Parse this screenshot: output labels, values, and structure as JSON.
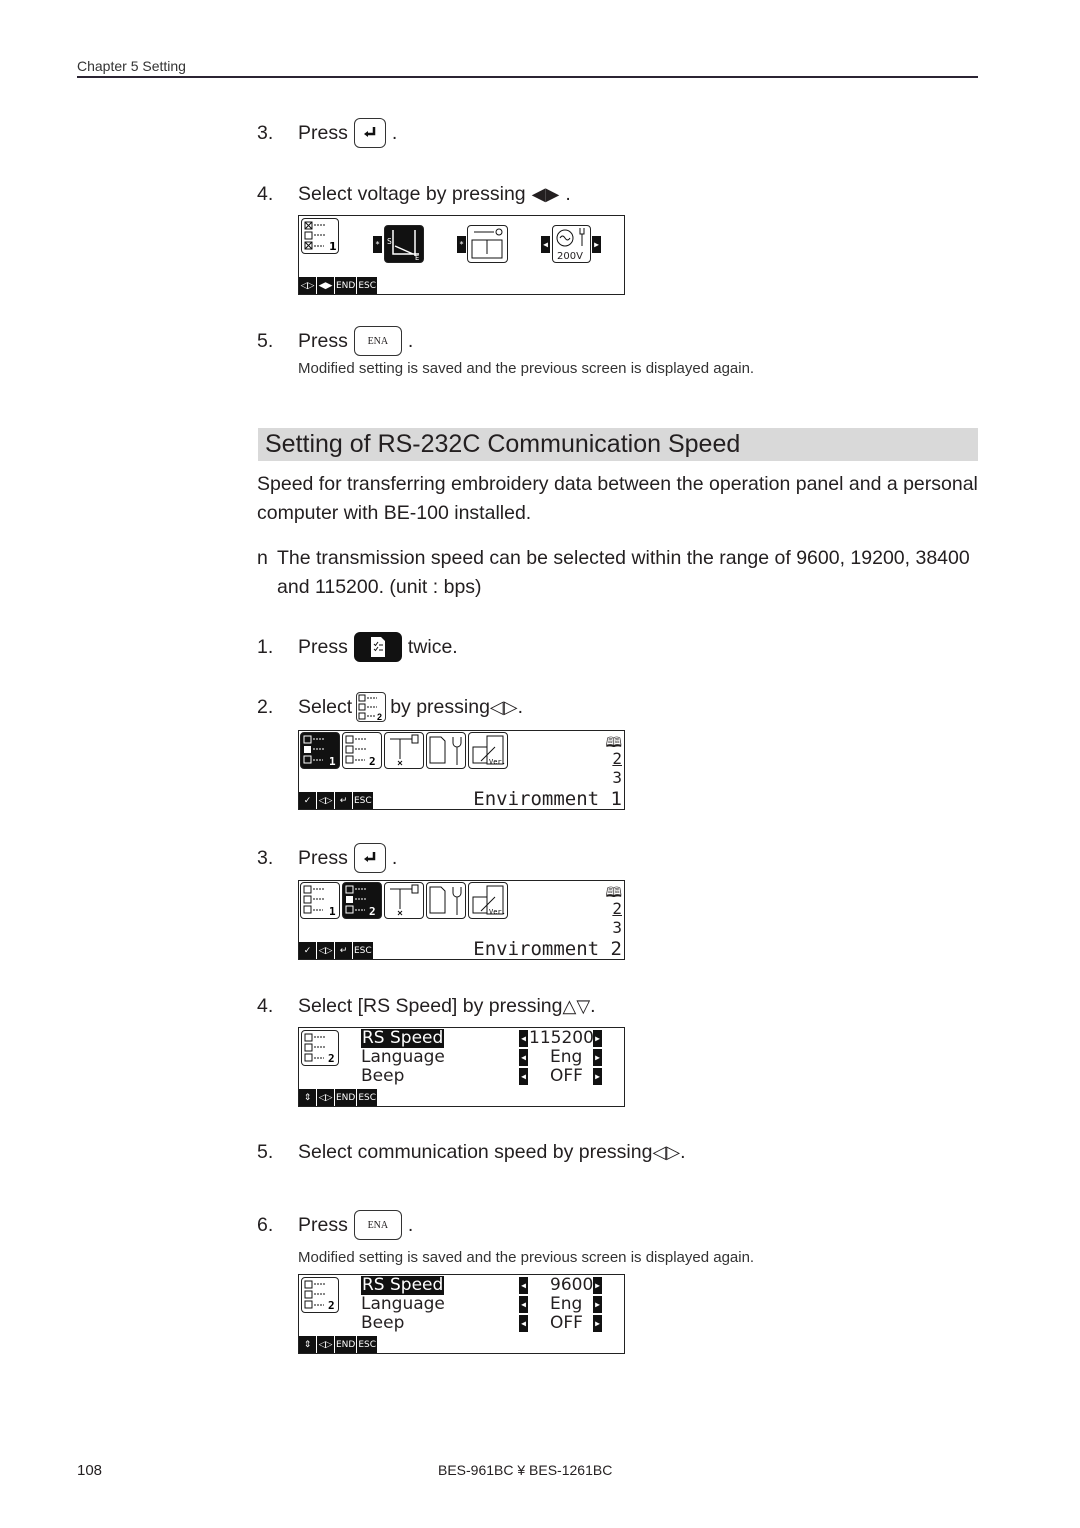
{
  "header": {
    "chapter": "Chapter 5 Setting"
  },
  "top_steps": [
    {
      "num": "3.",
      "text": "Press",
      "key": "enter-key",
      "after": "."
    },
    {
      "num": "4.",
      "text": "Select voltage by pressing",
      "key_glyph": "◀▶",
      "after": "."
    },
    {
      "num": "5.",
      "text": "Press",
      "key_label": "ENA",
      "after": ".",
      "note": "Modified setting is saved and the previous screen is displayed again."
    }
  ],
  "voltage_screen": {
    "value": "200V",
    "marker": "*",
    "softkeys": [
      "◁▷",
      "◀▶",
      "END",
      "ESC"
    ],
    "setting_icon_num": "1"
  },
  "section": {
    "title": "Setting of RS-232C Communication Speed",
    "intro": "Speed for transferring embroidery data between the operation panel and a personal computer with BE-100 installed.",
    "bullet_marker": "n",
    "bullet": "The transmission speed can be selected within the range of 9600, 19200, 38400 and 115200.  (unit : bps)"
  },
  "steps": [
    {
      "num": "1.",
      "text": "Press",
      "after": "twice."
    },
    {
      "num": "2.",
      "text": "Select",
      "after": "by pressing",
      "glyph": "◁▷",
      "end": "."
    },
    {
      "num": "3.",
      "text": "Press",
      "after": "."
    },
    {
      "num": "4.",
      "text": "Select [RS Speed] by pressing",
      "glyph": "△▽",
      "end": "."
    },
    {
      "num": "5.",
      "text": "Select communication speed by pressing",
      "glyph": "◁▷",
      "end": "."
    },
    {
      "num": "6.",
      "text": "Press",
      "key_label": "ENA",
      "after": ".",
      "note": "Modified setting is saved and the previous screen is displayed again."
    }
  ],
  "env_screens": [
    {
      "label": "Enviromment 1",
      "pages": [
        "2",
        "3"
      ],
      "selected": 1,
      "softkeys": [
        "✓",
        "◁▷",
        "↵",
        "ESC"
      ]
    },
    {
      "label": "Enviromment 2",
      "pages": [
        "2",
        "3"
      ],
      "selected": 2,
      "softkeys": [
        "✓",
        "◁▷",
        "↵",
        "ESC"
      ]
    }
  ],
  "settings_screens": [
    {
      "rows": [
        {
          "label": "RS Speed",
          "value": "115200"
        },
        {
          "label": "Language",
          "value": "Eng"
        },
        {
          "label": "Beep",
          "value": "OFF"
        }
      ],
      "softkeys": [
        "⇕",
        "◁▷",
        "END",
        "ESC"
      ],
      "icon_num": "2"
    },
    {
      "rows": [
        {
          "label": "RS Speed",
          "value": "9600"
        },
        {
          "label": "Language",
          "value": "Eng"
        },
        {
          "label": "Beep",
          "value": "OFF"
        }
      ],
      "softkeys": [
        "⇕",
        "◁▷",
        "END",
        "ESC"
      ],
      "icon_num": "2"
    }
  ],
  "footer": {
    "page": "108",
    "model": "BES-961BC ¥ BES-1261BC"
  }
}
